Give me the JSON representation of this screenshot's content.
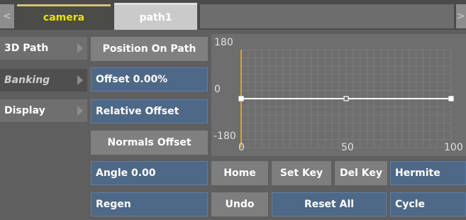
{
  "tabs": {
    "left_arrow": "<",
    "camera": "camera",
    "path": "path1",
    "right_arrow": ">"
  },
  "menu": {
    "items": [
      {
        "label": "3D Path"
      },
      {
        "label": "Banking"
      },
      {
        "label": "Display"
      }
    ]
  },
  "options": {
    "position_on_path": "Position On Path",
    "offset": "Offset 0.00%",
    "relative_offset": "Relative Offset",
    "normals_offset": "Normals Offset",
    "angle": "Angle 0.00",
    "regen": "Regen"
  },
  "graph": {
    "y_max_label": "180",
    "y_zero_label": "0",
    "y_min_label": "-180",
    "x_ticks": [
      "0",
      "50",
      "100"
    ],
    "curve_value": 0,
    "keys_x": [
      0,
      50,
      100
    ],
    "x_range": [
      0,
      100
    ],
    "y_range": [
      -180,
      180
    ],
    "colors": {
      "grid_bg": "#6e6e6e",
      "grid_line": "#7c7c7c",
      "curve": "#ffffff",
      "current_frame": "#e0a020"
    }
  },
  "buttons": {
    "home": "Home",
    "set_key": "Set Key",
    "del_key": "Del Key",
    "hermite": "Hermite",
    "undo": "Undo",
    "reset_all": "Reset All",
    "cycle": "Cycle"
  }
}
